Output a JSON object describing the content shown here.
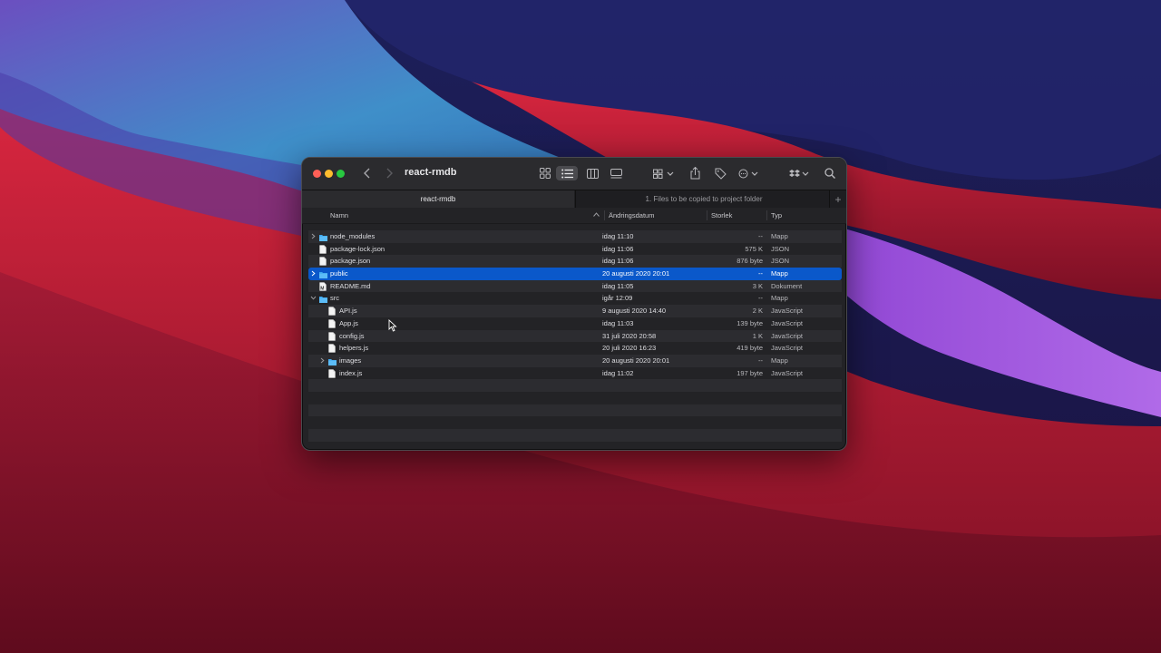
{
  "window": {
    "title": "react-rmdb"
  },
  "toolbar": {
    "icons": [
      "chevron-left-icon",
      "chevron-right-icon",
      "grid-view-icon",
      "list-view-icon",
      "column-view-icon",
      "gallery-view-icon",
      "group-icon",
      "share-icon",
      "tag-icon",
      "action-menu-icon",
      "dropbox-icon",
      "search-icon"
    ],
    "active_view": "list"
  },
  "tabs": [
    {
      "label": "react-rmdb",
      "active": true
    },
    {
      "label": "1. Files to be copied to project folder",
      "active": false
    }
  ],
  "columns": {
    "name": "Namn",
    "date": "Ändringsdatum",
    "size": "Storlek",
    "type": "Typ"
  },
  "files": [
    {
      "name": "node_modules",
      "date": "idag 11:10",
      "size": "--",
      "type": "Mapp",
      "kind": "folder",
      "depth": 0,
      "disclosure": "collapsed"
    },
    {
      "name": "package-lock.json",
      "date": "idag 11:06",
      "size": "575 K",
      "type": "JSON",
      "kind": "file",
      "depth": 0,
      "disclosure": "none"
    },
    {
      "name": "package.json",
      "date": "idag 11:06",
      "size": "876 byte",
      "type": "JSON",
      "kind": "file",
      "depth": 0,
      "disclosure": "none"
    },
    {
      "name": "public",
      "date": "20 augusti 2020 20:01",
      "size": "--",
      "type": "Mapp",
      "kind": "folder",
      "depth": 0,
      "disclosure": "collapsed",
      "selected": true
    },
    {
      "name": "README.md",
      "date": "idag 11:05",
      "size": "3 K",
      "type": "Dokument",
      "kind": "doc",
      "depth": 0,
      "disclosure": "none"
    },
    {
      "name": "src",
      "date": "igår 12:09",
      "size": "--",
      "type": "Mapp",
      "kind": "folder",
      "depth": 0,
      "disclosure": "expanded"
    },
    {
      "name": "API.js",
      "date": "9 augusti 2020 14:40",
      "size": "2 K",
      "type": "JavaScript",
      "kind": "file",
      "depth": 1,
      "disclosure": "none"
    },
    {
      "name": "App.js",
      "date": "idag 11:03",
      "size": "139 byte",
      "type": "JavaScript",
      "kind": "file",
      "depth": 1,
      "disclosure": "none"
    },
    {
      "name": "config.js",
      "date": "31 juli 2020 20:58",
      "size": "1 K",
      "type": "JavaScript",
      "kind": "file",
      "depth": 1,
      "disclosure": "none"
    },
    {
      "name": "helpers.js",
      "date": "20 juli 2020 16:23",
      "size": "419 byte",
      "type": "JavaScript",
      "kind": "file",
      "depth": 1,
      "disclosure": "none"
    },
    {
      "name": "images",
      "date": "20 augusti 2020 20:01",
      "size": "--",
      "type": "Mapp",
      "kind": "folder",
      "depth": 1,
      "disclosure": "collapsed"
    },
    {
      "name": "index.js",
      "date": "idag 11:02",
      "size": "197 byte",
      "type": "JavaScript",
      "kind": "file",
      "depth": 1,
      "disclosure": "none"
    }
  ],
  "empty_rows": 5,
  "colors": {
    "selection": "#0a58ca",
    "folder": "#3da8f0",
    "close": "#fe5f57",
    "minimize": "#febc2e",
    "maximize": "#28c840"
  }
}
